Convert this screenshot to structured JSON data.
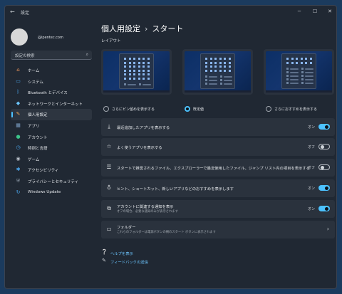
{
  "window": {
    "app_title": "設定",
    "back_icon": "back-arrow-icon",
    "controls": {
      "minimize": "─",
      "maximize": "☐",
      "close": "✕"
    }
  },
  "account": {
    "email": "@ipentec.com"
  },
  "search": {
    "placeholder": "設定の検索"
  },
  "sidebar": {
    "items": [
      {
        "label": "ホーム",
        "icon": "home-icon",
        "color": "#e8935a"
      },
      {
        "label": "システム",
        "icon": "system-icon",
        "color": "#4aa3e8"
      },
      {
        "label": "Bluetooth とデバイス",
        "icon": "bluetooth-icon",
        "color": "#4aa3e8"
      },
      {
        "label": "ネットワークとインターネット",
        "icon": "network-icon",
        "color": "#6cc6ff"
      },
      {
        "label": "個人用設定",
        "icon": "brush-icon",
        "color": "#e8a55a",
        "active": true
      },
      {
        "label": "アプリ",
        "icon": "apps-icon",
        "color": "#7ea1c8"
      },
      {
        "label": "アカウント",
        "icon": "account-icon",
        "color": "#3cc48a"
      },
      {
        "label": "時刻と言語",
        "icon": "time-language-icon",
        "color": "#4aa3e8"
      },
      {
        "label": "ゲーム",
        "icon": "gaming-icon",
        "color": "#b8bfc8"
      },
      {
        "label": "アクセシビリティ",
        "icon": "accessibility-icon",
        "color": "#4aa3e8"
      },
      {
        "label": "プライバシーとセキュリティ",
        "icon": "shield-icon",
        "color": "#8e9aa8"
      },
      {
        "label": "Windows Update",
        "icon": "update-icon",
        "color": "#4aa3e8"
      }
    ]
  },
  "page": {
    "breadcrumb_parent": "個人用設定",
    "breadcrumb_sep": "›",
    "title": "スタート",
    "layout_label": "レイアウト"
  },
  "layouts": [
    {
      "label": "さらにピン留めを表示する",
      "selected": false
    },
    {
      "label": "既定値",
      "selected": true
    },
    {
      "label": "さらにおすすめを表示する",
      "selected": false
    }
  ],
  "settings": [
    {
      "title": "最近追加したアプリを表示する",
      "icon": "download-icon",
      "state_label": "オン",
      "on": true
    },
    {
      "title": "よく使うアプリを表示する",
      "icon": "star-icon",
      "state_label": "オフ",
      "on": false
    },
    {
      "title": "スタートで推奨されるファイル、エクスプローラーで最近使用したファイル、ジャンプ リスト内の項目を表示する",
      "icon": "list-icon",
      "state_label": "オフ",
      "on": false
    },
    {
      "title": "ヒント、ショートカット、新しいアプリなどのおすすめを表示します",
      "icon": "lightbulb-icon",
      "state_label": "オン",
      "on": true
    },
    {
      "title": "アカウントに関連する通知を表示",
      "subtitle": "オフの場合、必要な通知のみが表示されます",
      "icon": "account-notification-icon",
      "state_label": "オン",
      "on": true
    },
    {
      "title": "フォルダー",
      "subtitle": "これらのフォルダーは電源ボタンの横のスタート ボタンに表示されます",
      "icon": "folder-icon",
      "chevron": "›"
    }
  ],
  "links": [
    {
      "label": "ヘルプを表示",
      "icon": "help-icon"
    },
    {
      "label": "フィードバックの送信",
      "icon": "feedback-icon"
    }
  ],
  "colors": {
    "accent": "#4cc2ff",
    "card": "#2a323d",
    "window": "#202833"
  }
}
